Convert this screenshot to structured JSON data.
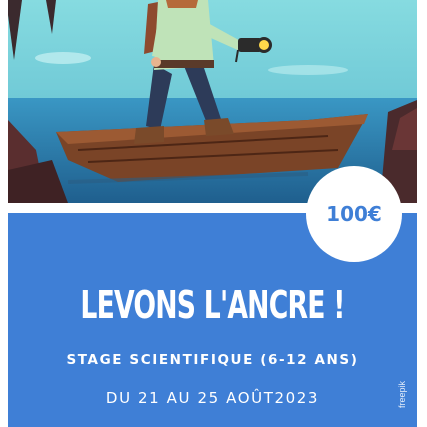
{
  "price": "100€",
  "title": "LEVONS L'ANCRE !",
  "subtitle": "STAGE SCIENTIFIQUE (6-12 ANS)",
  "dates": "DU 21 AU 25 AOÛT2023",
  "credit": "freepik",
  "colors": {
    "panel": "#3f7fd6",
    "sky": "#6fc9d3",
    "water": "#2f7eb3",
    "boat": "#6b3a22",
    "badge_text": "#3f7fd6"
  },
  "illustration": {
    "subject": "explorer with backpack and flashlight standing in a wooden boat"
  }
}
